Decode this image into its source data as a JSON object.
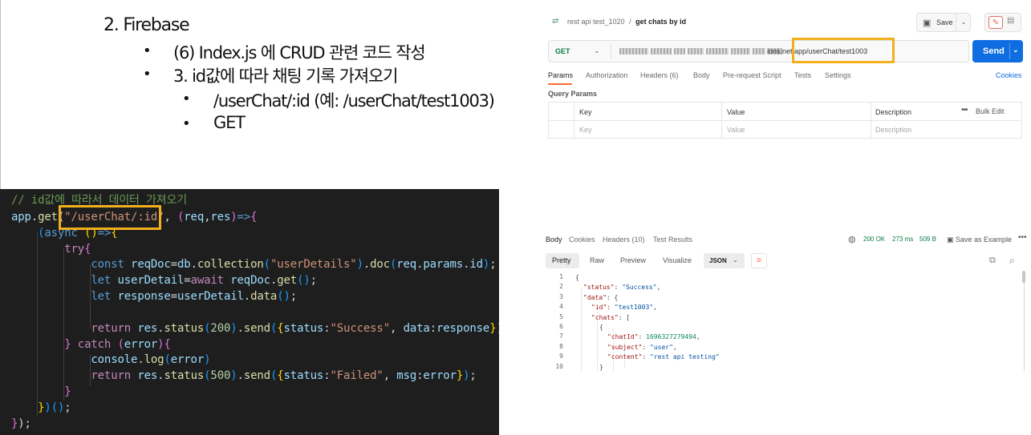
{
  "outline": {
    "heading": "2.   Firebase",
    "items": [
      {
        "bullet": "•",
        "text": "(6) Index.js 에 CRUD 관련 코드 작성"
      },
      {
        "bullet": "•",
        "text": "3. id값에 따라 채팅 기록 가져오기"
      }
    ],
    "subitems": [
      {
        "bullet": "•",
        "text": "/userChat/:id (예: /userChat/test1003)"
      },
      {
        "bullet": "•",
        "text": "GET"
      }
    ]
  },
  "code": {
    "comment": "// id값에 따라서 데이터 가져오기",
    "route": "\"/userChat/:id\""
  },
  "postman": {
    "breadcrumb_collection": "rest api test_1020",
    "breadcrumb_sep": "/",
    "request_name": "get chats by id",
    "save_label": "Save",
    "method": "GET",
    "url_visible": "ions.net/app/userChat/test1003",
    "send_label": "Send",
    "tabs": [
      "Params",
      "Authorization",
      "Headers (6)",
      "Body",
      "Pre-request Script",
      "Tests",
      "Settings"
    ],
    "cookies_label": "Cookies",
    "query_params_label": "Query Params",
    "table_headers": [
      "Key",
      "Value",
      "Description"
    ],
    "bulk_edit_label": "Bulk Edit",
    "placeholders": [
      "Key",
      "Value",
      "Description"
    ]
  },
  "response": {
    "tabs": [
      "Body",
      "Cookies",
      "Headers (10)",
      "Test Results"
    ],
    "status": "200 OK",
    "time": "273 ms",
    "size": "509 B",
    "save_example_label": "Save as Example",
    "format_tabs": [
      "Pretty",
      "Raw",
      "Preview",
      "Visualize"
    ],
    "format_select": "JSON",
    "json_lines": [
      {
        "n": "1",
        "t": "{"
      },
      {
        "n": "2",
        "k": "\"status\"",
        "v": "\"Success\"",
        "e": ","
      },
      {
        "n": "3",
        "k": "\"data\"",
        "p": "{"
      },
      {
        "n": "4",
        "k": "\"id\"",
        "v": "\"test1003\"",
        "e": ","
      },
      {
        "n": "5",
        "k": "\"chats\"",
        "p": "["
      },
      {
        "n": "6",
        "t": "{"
      },
      {
        "n": "7",
        "k": "\"chatId\"",
        "num": "1696327279494",
        "e": ","
      },
      {
        "n": "8",
        "k": "\"subject\"",
        "v": "\"user\"",
        "e": ","
      },
      {
        "n": "9",
        "k": "\"content\"",
        "v": "\"rest api testing\""
      },
      {
        "n": "10",
        "t": "}"
      }
    ]
  },
  "colors": {
    "highlight": "#f2b01e",
    "send": "#0e6ee1",
    "postman_accent": "#ff6c37",
    "code_bg": "#1e1e1e"
  }
}
